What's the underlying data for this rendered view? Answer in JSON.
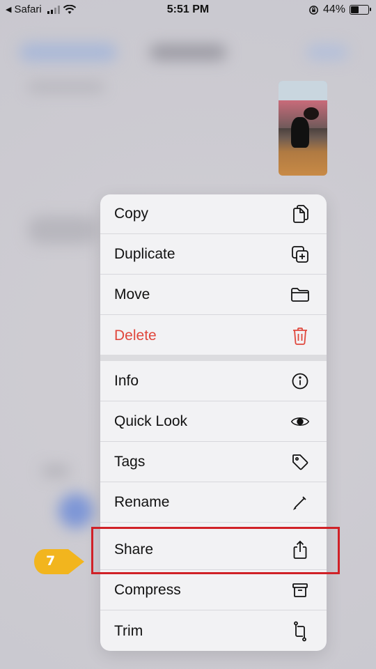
{
  "status_bar": {
    "back_app": "Safari",
    "time": "5:51 PM",
    "battery": "44%"
  },
  "context_menu": {
    "items": [
      {
        "label": "Copy",
        "icon": "copy-icon"
      },
      {
        "label": "Duplicate",
        "icon": "duplicate-icon"
      },
      {
        "label": "Move",
        "icon": "folder-icon"
      },
      {
        "label": "Delete",
        "icon": "trash-icon",
        "color": "#e0473c"
      },
      {
        "label": "Info",
        "icon": "info-icon"
      },
      {
        "label": "Quick Look",
        "icon": "eye-icon"
      },
      {
        "label": "Tags",
        "icon": "tag-icon"
      },
      {
        "label": "Rename",
        "icon": "pencil-icon"
      },
      {
        "label": "Share",
        "icon": "share-icon"
      },
      {
        "label": "Compress",
        "icon": "archive-icon"
      },
      {
        "label": "Trim",
        "icon": "crop-icon"
      }
    ]
  },
  "annotation": {
    "step_number": "7",
    "highlight_color": "#d02127",
    "badge_color": "#f2b51e"
  }
}
